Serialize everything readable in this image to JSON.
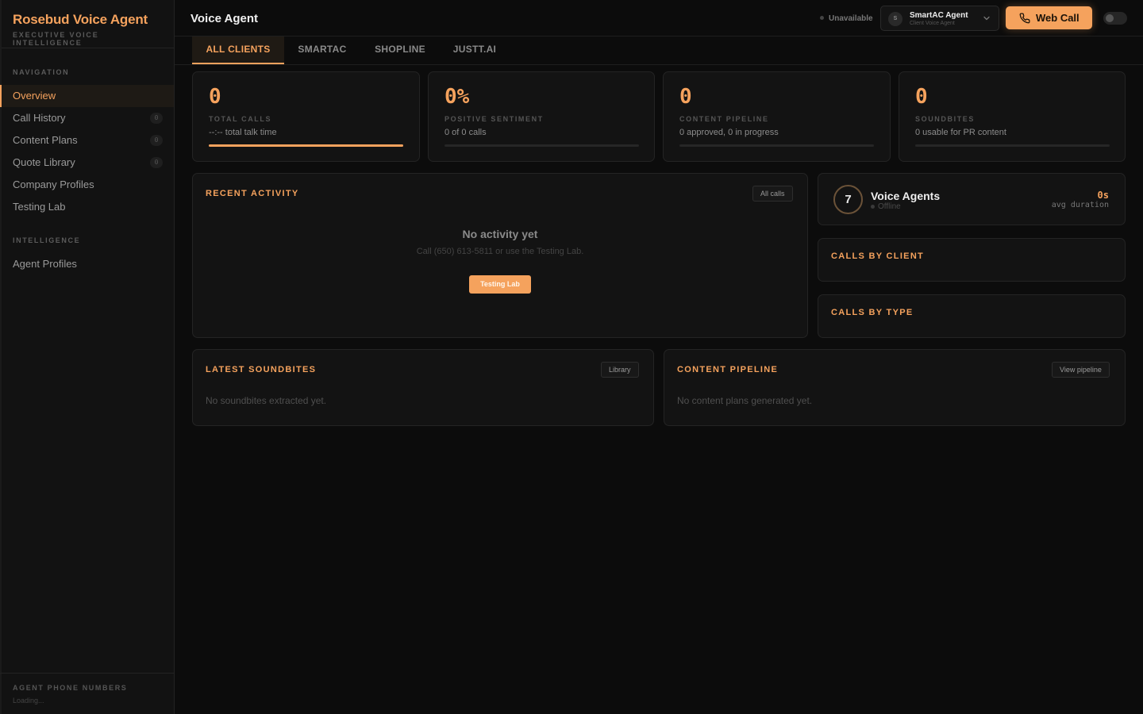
{
  "brand": {
    "title": "Rosebud Voice Agent",
    "subtitle": "EXECUTIVE VOICE INTELLIGENCE"
  },
  "sidebar": {
    "sections": [
      {
        "label": "NAVIGATION",
        "items": [
          {
            "label": "Overview",
            "active": true
          },
          {
            "label": "Call History",
            "badge": "0"
          },
          {
            "label": "Content Plans",
            "badge": "0"
          },
          {
            "label": "Quote Library",
            "badge": "0"
          },
          {
            "label": "Company Profiles"
          },
          {
            "label": "Testing Lab"
          }
        ]
      },
      {
        "label": "INTELLIGENCE",
        "items": [
          {
            "label": "Agent Profiles"
          }
        ]
      }
    ],
    "footer": {
      "label": "AGENT PHONE NUMBERS",
      "value": "Loading..."
    }
  },
  "header": {
    "title": "Voice Agent",
    "status": "Unavailable",
    "agent": {
      "initial": "S",
      "name": "SmartAC Agent",
      "role": "Client Voice Agent"
    },
    "call_button": "Web Call"
  },
  "tabs": [
    {
      "label": "ALL CLIENTS",
      "active": true
    },
    {
      "label": "SMARTAC"
    },
    {
      "label": "SHOPLINE"
    },
    {
      "label": "JUSTT.AI"
    }
  ],
  "stats": [
    {
      "value": "0",
      "label": "TOTAL CALLS",
      "sub": "--:-- total talk time",
      "progress": 1.0
    },
    {
      "value": "0%",
      "label": "POSITIVE SENTIMENT",
      "sub": "0 of 0 calls",
      "progress": 0
    },
    {
      "value": "0",
      "label": "CONTENT PIPELINE",
      "sub": "0 approved, 0 in progress",
      "progress": 0
    },
    {
      "value": "0",
      "label": "SOUNDBITES",
      "sub": "0 usable for PR content",
      "progress": 0
    }
  ],
  "recent_activity": {
    "title": "RECENT ACTIVITY",
    "button": "All calls",
    "empty_title": "No activity yet",
    "empty_sub": "Call (650) 613-5811 or use the Testing Lab.",
    "action": "Testing Lab"
  },
  "voice_agents": {
    "count": "7",
    "title": "Voice Agents",
    "status": "Offline",
    "avg": "0s",
    "avg_label": "avg duration"
  },
  "calls_by_client": {
    "title": "CALLS BY CLIENT"
  },
  "calls_by_type": {
    "title": "CALLS BY TYPE"
  },
  "soundbites": {
    "title": "LATEST SOUNDBITES",
    "button": "Library",
    "empty": "No soundbites extracted yet."
  },
  "pipeline": {
    "title": "CONTENT PIPELINE",
    "button": "View pipeline",
    "empty": "No content plans generated yet."
  },
  "colors": {
    "accent": "#f5a25d",
    "background": "#0c0c0c",
    "panel": "#131313"
  }
}
